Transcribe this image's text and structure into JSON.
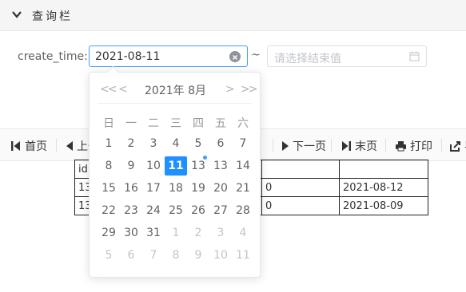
{
  "query_panel": {
    "title": "查询栏"
  },
  "filter": {
    "label": "create_time:",
    "start_value": "2021-08-11",
    "separator": "~",
    "end_placeholder": "请选择结束值"
  },
  "toolbar": {
    "first": "首页",
    "prev": "上一页",
    "next": "下一页",
    "last": "末页",
    "print": "打印",
    "export": "导出"
  },
  "table": {
    "rows": [
      [
        "id",
        "",
        ""
      ],
      [
        "13",
        "0",
        "2021-08-12"
      ],
      [
        "13",
        "0",
        "2021-08-09"
      ]
    ]
  },
  "datepicker": {
    "title": "2021年 8月",
    "nav": {
      "prev_year": "<<",
      "prev_month": "<",
      "next_month": ">",
      "next_year": ">>"
    },
    "weekdays": [
      "日",
      "一",
      "二",
      "三",
      "四",
      "五",
      "六"
    ],
    "weeks": [
      [
        [
          "1",
          ""
        ],
        [
          "2",
          ""
        ],
        [
          "3",
          ""
        ],
        [
          "4",
          ""
        ],
        [
          "5",
          ""
        ],
        [
          "6",
          ""
        ],
        [
          "7",
          ""
        ]
      ],
      [
        [
          "8",
          ""
        ],
        [
          "9",
          ""
        ],
        [
          "10",
          ""
        ],
        [
          "11",
          "selected"
        ],
        [
          "13",
          "today"
        ],
        [
          "13",
          ""
        ],
        [
          "14",
          ""
        ]
      ],
      [
        [
          "15",
          ""
        ],
        [
          "16",
          ""
        ],
        [
          "17",
          ""
        ],
        [
          "18",
          ""
        ],
        [
          "19",
          ""
        ],
        [
          "20",
          ""
        ],
        [
          "21",
          ""
        ]
      ],
      [
        [
          "22",
          ""
        ],
        [
          "23",
          ""
        ],
        [
          "24",
          ""
        ],
        [
          "25",
          ""
        ],
        [
          "26",
          ""
        ],
        [
          "27",
          ""
        ],
        [
          "28",
          ""
        ]
      ],
      [
        [
          "29",
          ""
        ],
        [
          "30",
          ""
        ],
        [
          "31",
          ""
        ],
        [
          "1",
          "other"
        ],
        [
          "2",
          "other"
        ],
        [
          "3",
          "other"
        ],
        [
          "4",
          "other"
        ]
      ],
      [
        [
          "5",
          "other"
        ],
        [
          "6",
          "other"
        ],
        [
          "7",
          "other"
        ],
        [
          "8",
          "other"
        ],
        [
          "9",
          "other"
        ],
        [
          "10",
          "other"
        ],
        [
          "11",
          "other"
        ]
      ]
    ]
  },
  "colors": {
    "accent": "#409eff",
    "selected": "#1e90ff",
    "muted": "#c0c4cc"
  }
}
